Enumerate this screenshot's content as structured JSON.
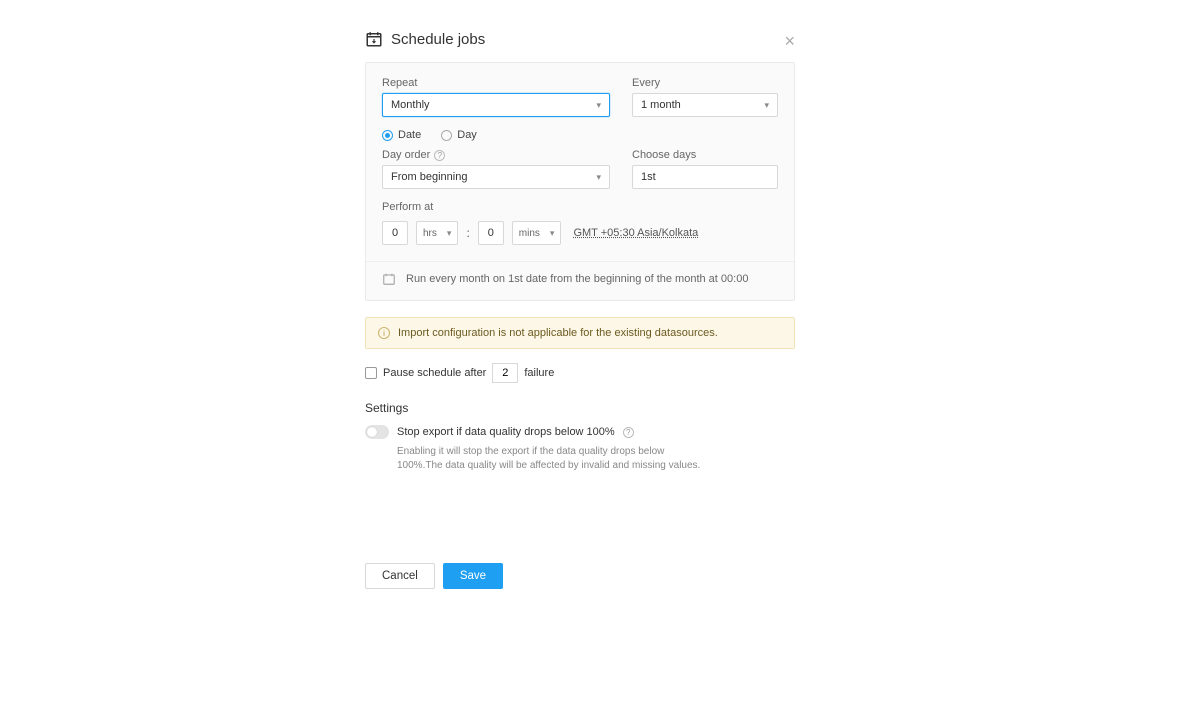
{
  "header": {
    "title": "Schedule jobs"
  },
  "schedule": {
    "repeat_label": "Repeat",
    "repeat_value": "Monthly",
    "every_label": "Every",
    "every_value": "1 month",
    "radio_date": "Date",
    "radio_day": "Day",
    "dayorder_label": "Day order",
    "dayorder_value": "From beginning",
    "choosedays_label": "Choose days",
    "choosedays_value": "1st",
    "perform_label": "Perform at",
    "hrs_value": "0",
    "hrs_unit": "hrs",
    "mins_value": "0",
    "mins_unit": "mins",
    "tz": "GMT +05:30 Asia/Kolkata",
    "summary": "Run every month on 1st date from the beginning of the month at 00:00"
  },
  "alert": {
    "text": "Import configuration is not applicable for the existing datasources."
  },
  "pause": {
    "prefix": "Pause schedule after",
    "value": "2",
    "suffix": "failure"
  },
  "settings": {
    "heading": "Settings",
    "toggle_label": "Stop export if data quality drops below 100%",
    "desc": "Enabling it will stop the export if the data quality drops below 100%.The data quality will be affected by invalid and missing values."
  },
  "buttons": {
    "cancel": "Cancel",
    "save": "Save"
  }
}
